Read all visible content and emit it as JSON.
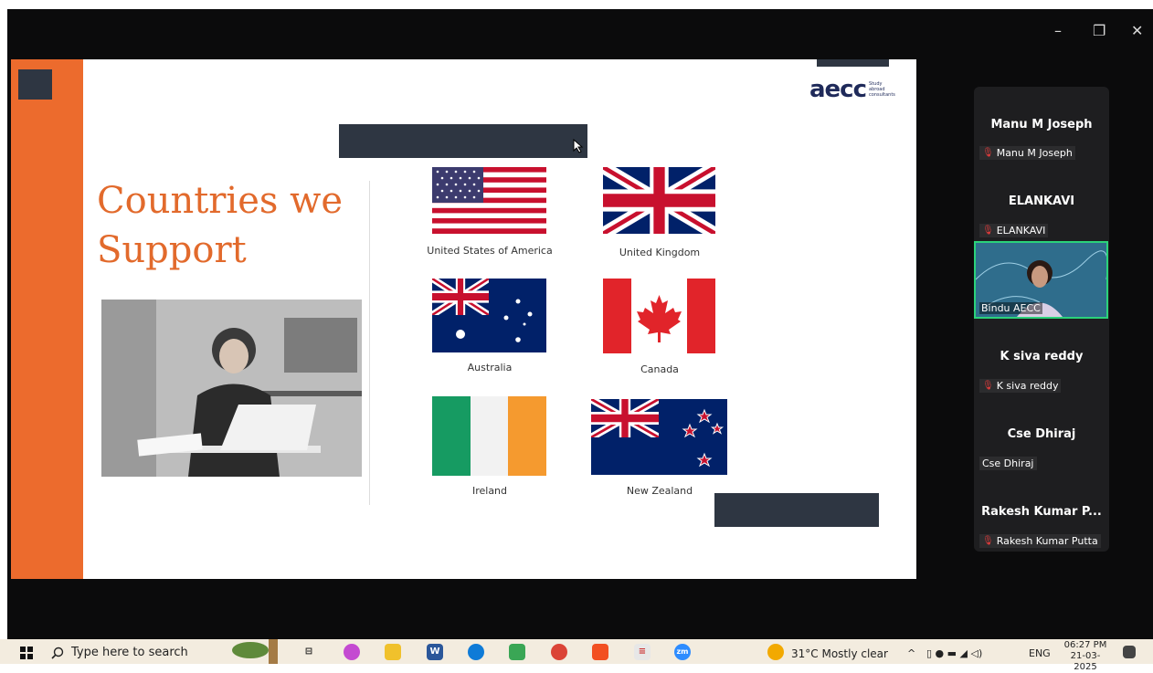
{
  "window": {
    "controls": {
      "minimize": "–",
      "restore": "❐",
      "close": "✕"
    }
  },
  "slide": {
    "title_line1": "Countries we",
    "title_line2": "Support",
    "logo_main": "aecc",
    "logo_sub": "Study abroad consultants",
    "countries": [
      "United States of America",
      "United Kingdom",
      "Australia",
      "Canada",
      "Ireland",
      "New Zealand"
    ]
  },
  "participants": [
    {
      "name": "Manu M Joseph",
      "tag": "Manu M Joseph",
      "muted": true
    },
    {
      "name": "ELANKAVI",
      "tag": "ELANKAVI",
      "muted": true
    },
    {
      "name": "Bindu AECC",
      "tag": "Bindu AECC",
      "video": true
    },
    {
      "name": "K siva reddy",
      "tag": "K siva reddy",
      "muted": true
    },
    {
      "name": "Cse Dhiraj",
      "tag": "Cse Dhiraj",
      "muted": false
    },
    {
      "name": "Rakesh Kumar P...",
      "tag": "Rakesh Kumar Putta",
      "muted": true
    }
  ],
  "taskbar": {
    "search_placeholder": "Type here to search",
    "weather": "31°C  Mostly clear",
    "language": "ENG",
    "time": "06:27 PM",
    "date": "21-03-2025"
  },
  "colors": {
    "accent_orange": "#ec6b2d",
    "dark_block": "#2e3642",
    "active_speaker": "#2bd27a"
  }
}
